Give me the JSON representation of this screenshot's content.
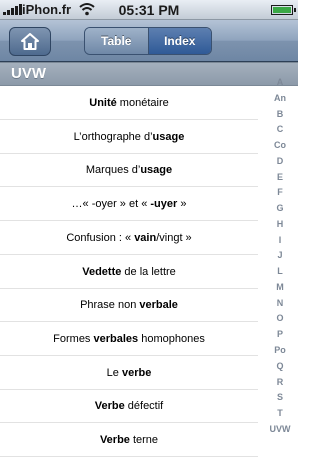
{
  "status_bar": {
    "carrier": "iPhon.fr",
    "time": "05:31 PM"
  },
  "nav": {
    "home_icon": "home-icon",
    "segments": [
      "Table",
      "Index"
    ],
    "selected_segment": "Index"
  },
  "section": {
    "title": "UVW"
  },
  "rows": [
    {
      "before": "",
      "bold": "Unité",
      "after": " monétaire"
    },
    {
      "before": "L’orthographe d’",
      "bold": "usage",
      "after": ""
    },
    {
      "before": "Marques d’",
      "bold": "usage",
      "after": ""
    },
    {
      "before": "…« -oyer » et « ",
      "bold": "-uyer",
      "after": " »"
    },
    {
      "before": "Confusion : « ",
      "bold": "vain",
      "after": "/vingt »"
    },
    {
      "before": "",
      "bold": "Vedette",
      "after": " de la lettre"
    },
    {
      "before": "Phrase non ",
      "bold": "verbale",
      "after": ""
    },
    {
      "before": "Formes ",
      "bold": "verbales",
      "after": " homophones"
    },
    {
      "before": "Le ",
      "bold": "verbe",
      "after": ""
    },
    {
      "before": "",
      "bold": "Verbe",
      "after": " défectif"
    },
    {
      "before": "",
      "bold": "Verbe",
      "after": " terne"
    }
  ],
  "index_letters": [
    "A",
    "An",
    "B",
    "C",
    "Co",
    "D",
    "E",
    "F",
    "G",
    "H",
    "I",
    "J",
    "L",
    "M",
    "N",
    "O",
    "P",
    "Po",
    "Q",
    "R",
    "S",
    "T",
    "UVW"
  ]
}
